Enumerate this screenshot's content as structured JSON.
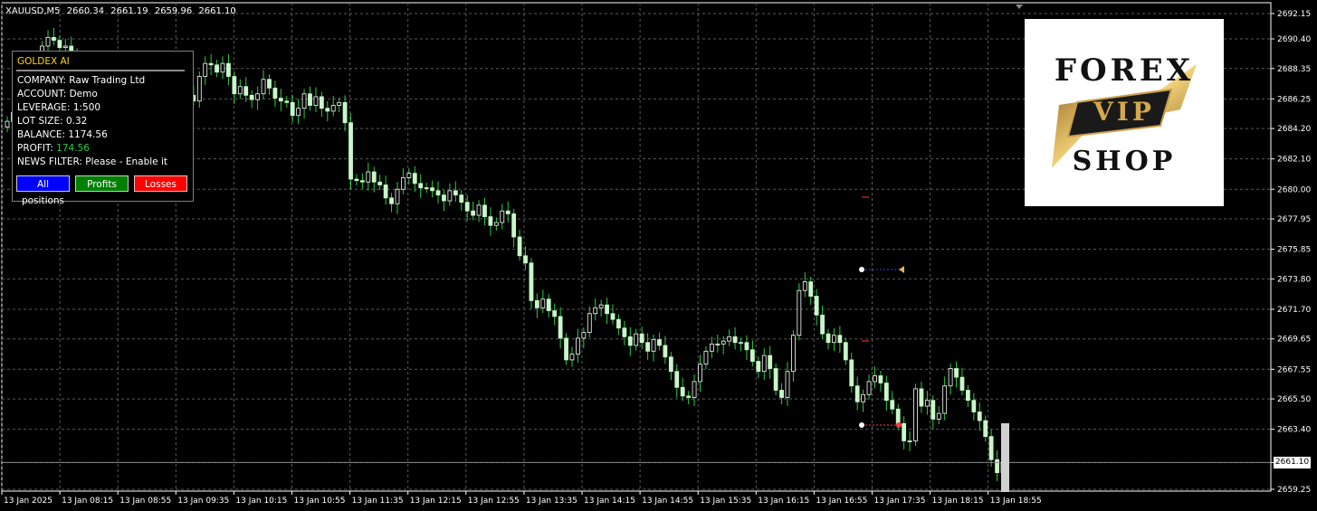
{
  "header": {
    "symbol": "XAUUSD,M5",
    "open": "2660.34",
    "high": "2661.19",
    "low": "2659.96",
    "close": "2661.10"
  },
  "panel": {
    "title": "GOLDEX AI",
    "company": "COMPANY: Raw Trading Ltd",
    "account": "ACCOUNT: Demo",
    "leverage": "LEVERAGE: 1:500",
    "lot_size": "LOT SIZE: 0.32",
    "balance": "BALANCE: 1174.56",
    "profit_label": "PROFIT:",
    "profit_value": "174.56",
    "news_filter": "NEWS FILTER: Please - Enable it",
    "buttons": {
      "all_positions": "All positions",
      "profits": "Profits",
      "losses": "Losses"
    }
  },
  "logo": {
    "line1": "FOREX",
    "badge": "VIP",
    "line2": "SHOP"
  },
  "price_axis": [
    "2692.15",
    "2690.40",
    "2688.35",
    "2686.25",
    "2684.20",
    "2682.10",
    "2680.00",
    "2677.95",
    "2675.85",
    "2673.80",
    "2671.70",
    "2669.65",
    "2667.55",
    "2665.50",
    "2663.40",
    "2661.10",
    "2659.25"
  ],
  "current_price": "2661.10",
  "time_axis": [
    "13 Jan 2025",
    "13 Jan 08:15",
    "13 Jan 08:55",
    "13 Jan 09:35",
    "13 Jan 10:15",
    "13 Jan 10:55",
    "13 Jan 11:35",
    "13 Jan 12:15",
    "13 Jan 12:55",
    "13 Jan 13:35",
    "13 Jan 14:15",
    "13 Jan 14:55",
    "13 Jan 15:35",
    "13 Jan 16:15",
    "13 Jan 16:55",
    "13 Jan 17:35",
    "13 Jan 18:15",
    "13 Jan 18:55"
  ],
  "colors": {
    "background": "#000000",
    "grid": "#5a5a5a",
    "candle_bull": "#ffffff",
    "candle_bear": "#c8f7c8",
    "wick": "#2ecc40",
    "button_blue": "#0000ff",
    "button_green": "#008000",
    "button_red": "#ff0000",
    "title_yellow": "#ffd700",
    "profit_green": "#2ecc40"
  },
  "chart_data": {
    "type": "candlestick",
    "symbol": "XAUUSD,M5",
    "ylim": [
      2659.25,
      2692.15
    ],
    "grid": true,
    "candles_close": [
      2684.7,
      2685.3,
      2686.2,
      2686.9,
      2687.4,
      2688.8,
      2689.9,
      2690.5,
      2690.3,
      2689.8,
      2689.9,
      2689.4,
      2688.9,
      2688.1,
      2687.1,
      2686.4,
      2685.6,
      2686.0,
      2686.6,
      2685.9,
      2686.5,
      2686.3,
      2685.2,
      2685.8,
      2686.4,
      2686.8,
      2688.1,
      2688.3,
      2688.9,
      2688.6,
      2687.9,
      2686.5,
      2686.1,
      2687.8,
      2688.7,
      2688.6,
      2688.1,
      2688.7,
      2687.8,
      2686.6,
      2687.1,
      2686.5,
      2686.2,
      2686.6,
      2687.6,
      2687.0,
      2686.3,
      2686.1,
      2686.0,
      2685.1,
      2685.6,
      2686.6,
      2685.8,
      2686.4,
      2685.6,
      2685.4,
      2685.8,
      2686.0,
      2684.6,
      2680.7,
      2680.6,
      2680.5,
      2681.2,
      2680.5,
      2680.3,
      2679.4,
      2679.0,
      2680.0,
      2680.8,
      2681.1,
      2680.4,
      2680.1,
      2680.1,
      2679.9,
      2679.6,
      2679.2,
      2679.9,
      2679.6,
      2679.1,
      2678.5,
      2678.2,
      2678.9,
      2678.1,
      2677.5,
      2677.7,
      2678.5,
      2678.3,
      2676.7,
      2675.4,
      2674.9,
      2672.3,
      2671.8,
      2672.4,
      2671.6,
      2671.2,
      2669.7,
      2668.2,
      2668.6,
      2669.7,
      2670.1,
      2671.4,
      2671.8,
      2672.0,
      2671.4,
      2671.0,
      2670.4,
      2669.8,
      2669.2,
      2670.0,
      2669.4,
      2668.8,
      2669.6,
      2669.2,
      2668.4,
      2667.4,
      2666.3,
      2665.7,
      2665.6,
      2666.7,
      2667.9,
      2668.8,
      2669.3,
      2669.3,
      2669.5,
      2669.8,
      2669.4,
      2669.4,
      2668.9,
      2668.1,
      2667.4,
      2668.5,
      2667.6,
      2666.1,
      2665.6,
      2667.4,
      2669.9,
      2673.0,
      2673.6,
      2672.6,
      2671.3,
      2670.0,
      2669.4,
      2669.9,
      2669.4,
      2668.2,
      2666.4,
      2665.3,
      2665.8,
      2666.7,
      2667.1,
      2666.6,
      2665.4,
      2664.8,
      2663.8,
      2662.6,
      2662.6,
      2666.2,
      2665.0,
      2665.4,
      2664.1,
      2664.5,
      2666.4,
      2667.6,
      2667.0,
      2666.1,
      2665.4,
      2664.6,
      2664.0,
      2662.9,
      2661.3,
      2660.4,
      2661.1
    ]
  }
}
